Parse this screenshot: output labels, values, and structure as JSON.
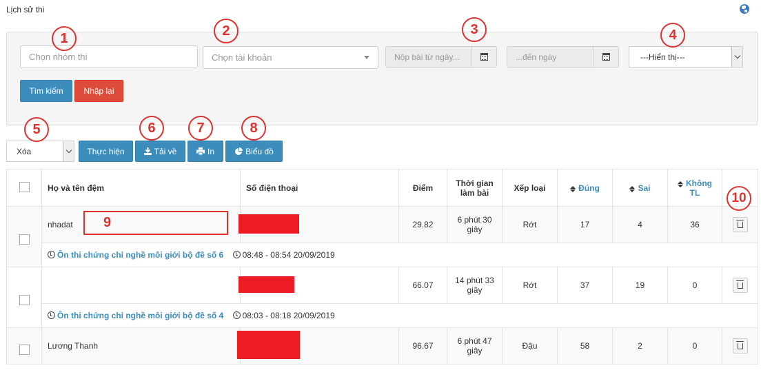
{
  "page": {
    "title": "Lịch sử thi"
  },
  "filters": {
    "group_placeholder": "Chọn nhóm thi",
    "account_placeholder": "Chọn tài khoản",
    "date_from_placeholder": "Nộp bài từ ngày...",
    "date_to_placeholder": "...đến ngày",
    "display_selected": "---Hiển thị---",
    "search_label": "Tìm kiếm",
    "reset_label": "Nhập lại"
  },
  "actions": {
    "bulk_selected": "Xóa",
    "execute_label": "Thực hiện",
    "download_label": "Tải về",
    "print_label": "In",
    "chart_label": "Biểu đồ"
  },
  "annotations": [
    "1",
    "2",
    "3",
    "4",
    "5",
    "6",
    "7",
    "8",
    "9",
    "10"
  ],
  "table": {
    "headers": {
      "name": "Họ và tên đệm",
      "phone": "Số điện thoại",
      "score": "Điểm",
      "time_line1": "Thời gian",
      "time_line2": "làm bài",
      "rank": "Xếp loại",
      "correct": "Đúng",
      "wrong": "Sai",
      "unanswered_line1": "Không",
      "unanswered_line2": "TL"
    },
    "rows": [
      {
        "name": "nhadat",
        "score": "29.82",
        "time_line1": "6 phút 30",
        "time_line2": "giây",
        "rank": "Rớt",
        "correct": "17",
        "wrong": "4",
        "unanswered": "36",
        "exam": "Ôn thi chứng chỉ nghề môi giới bộ đề số 6",
        "when": "08:48 - 08:54 20/09/2019"
      },
      {
        "name": "",
        "score": "66.07",
        "time_line1": "14 phút 33",
        "time_line2": "giây",
        "rank": "Rớt",
        "correct": "37",
        "wrong": "19",
        "unanswered": "0",
        "exam": "Ôn thi chứng chỉ nghề môi giới bộ đề số 4",
        "when": "08:03 - 08:18 20/09/2019"
      },
      {
        "name": "Lương Thanh",
        "score": "96.67",
        "time_line1": "6 phút 47",
        "time_line2": "giây",
        "rank": "Đậu",
        "correct": "58",
        "wrong": "2",
        "unanswered": "0"
      }
    ]
  },
  "colors": {
    "primary": "#3c8dbc",
    "danger": "#dd4b39",
    "annotation": "#e0302e",
    "redaction": "#ed1c24"
  }
}
